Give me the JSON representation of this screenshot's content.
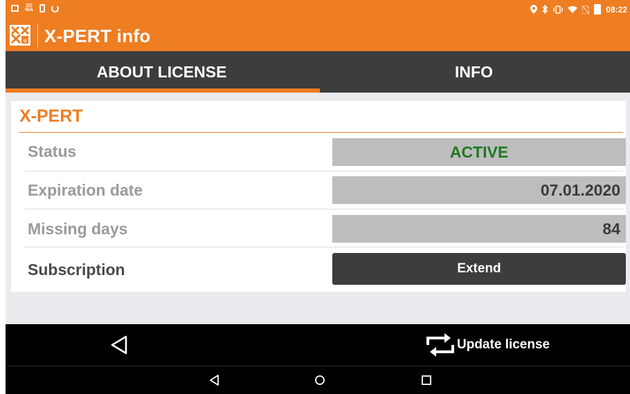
{
  "status_bar": {
    "time": "08:22",
    "left_icons": [
      "gallery-icon",
      "network-2g-icon",
      "clipboard-icon",
      "sync-icon"
    ],
    "right_icons": [
      "location-icon",
      "bluetooth-icon",
      "vibrate-icon",
      "wifi-icon",
      "no-sim-icon",
      "battery-icon"
    ]
  },
  "app": {
    "title": "X-PERT info",
    "logo_icon": "xpert-logo-icon",
    "accent_color": "#ef7d22",
    "dark_color": "#3d3d3d"
  },
  "tabs": [
    {
      "label": "ABOUT LICENSE",
      "selected": true
    },
    {
      "label": "INFO",
      "selected": false
    }
  ],
  "card": {
    "title": "X-PERT",
    "rows": [
      {
        "label": "Status",
        "value": "ACTIVE",
        "value_color": "#1d7a1f"
      },
      {
        "label": "Expiration date",
        "value": "07.01.2020"
      },
      {
        "label": "Missing days",
        "value": "84"
      }
    ],
    "subscription": {
      "label": "Subscription",
      "button_label": "Extend"
    }
  },
  "action_bar": {
    "back_icon": "back-arrow-icon",
    "update_label": "Update license",
    "update_icon": "refresh-icon"
  },
  "system_nav": [
    "nav-back-icon",
    "nav-home-icon",
    "nav-recents-icon"
  ]
}
